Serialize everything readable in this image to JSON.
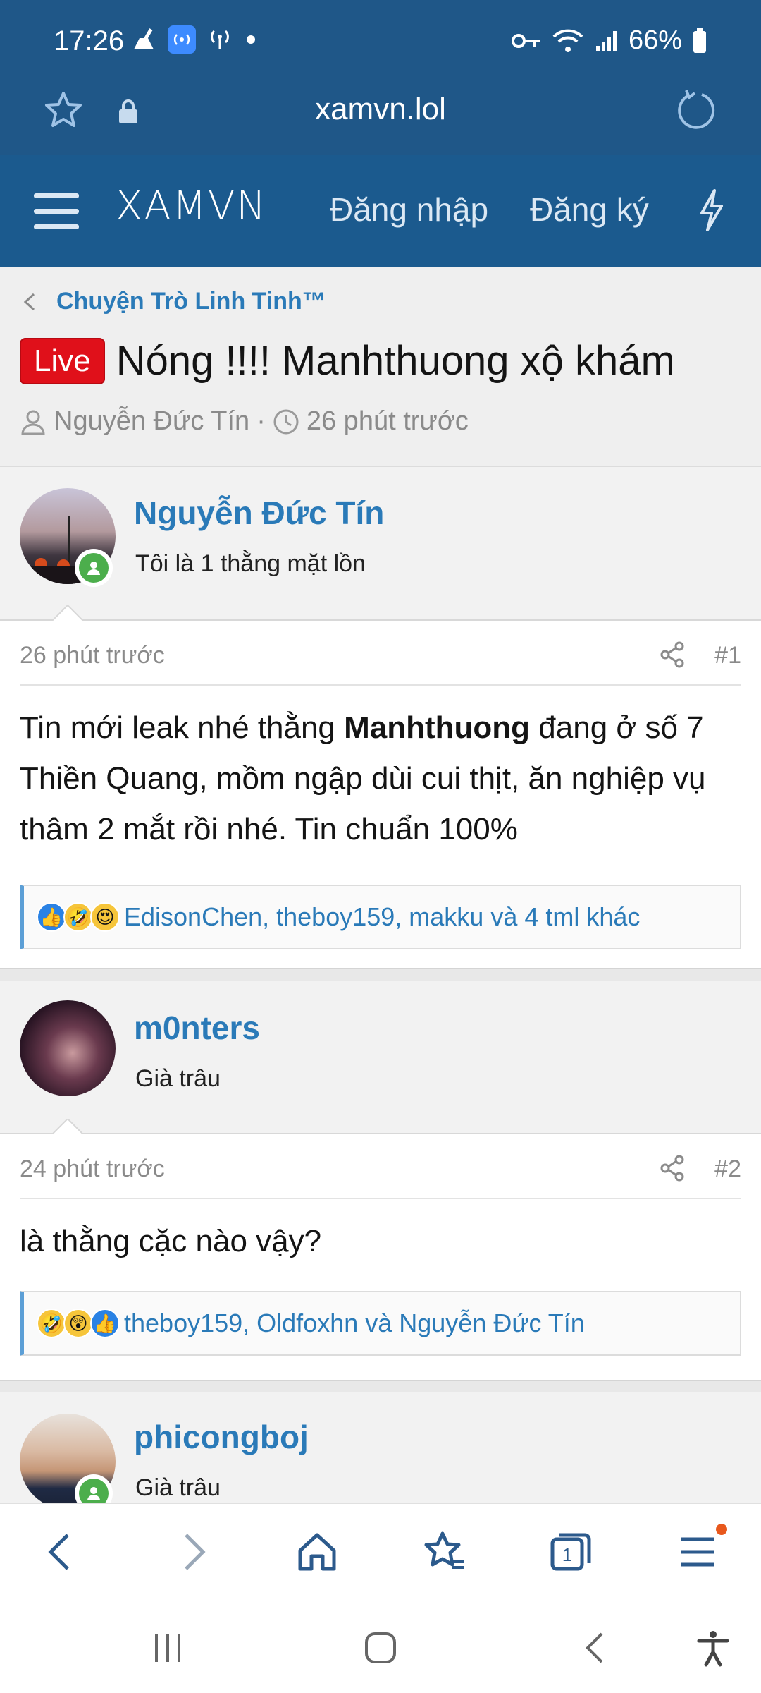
{
  "status": {
    "time": "17:26",
    "battery": "66%"
  },
  "browser": {
    "url": "xamvn.lol"
  },
  "site": {
    "logo": "XAMVN",
    "login": "Đăng nhập",
    "register": "Đăng ký"
  },
  "thread": {
    "breadcrumb": "Chuyện Trò Linh Tinh™",
    "badge": "Live",
    "title": "Nóng !!!! Manhthuong xộ khám",
    "author": "Nguyễn Đức Tín",
    "separator": "·",
    "time": "26 phút trước"
  },
  "posts": [
    {
      "username": "Nguyễn Đức Tín",
      "user_title": "Tôi là 1 thằng mặt lồn",
      "time": "26 phút trước",
      "number": "#1",
      "content_before": "Tin mới leak nhé thằng ",
      "content_bold": "Manhthuong",
      "content_after": " đang ở số 7 Thiền Quang, mồm ngập dùi cui thịt, ăn nghiệp vụ thâm 2 mắt rồi nhé. Tin chuẩn 100%",
      "reactions": "EdisonChen, theboy159, makku và 4 tml khác"
    },
    {
      "username": "m0nters",
      "user_title": "Già trâu",
      "time": "24 phút trước",
      "number": "#2",
      "content": "là thằng cặc nào vậy?",
      "reactions": "theboy159, Oldfoxhn và Nguyễn Đức Tín"
    },
    {
      "username": "phicongboj",
      "user_title": "Già trâu"
    }
  ],
  "colors": {
    "header": "#1f5788",
    "link": "#2a7ab8",
    "live": "#e0101a"
  }
}
